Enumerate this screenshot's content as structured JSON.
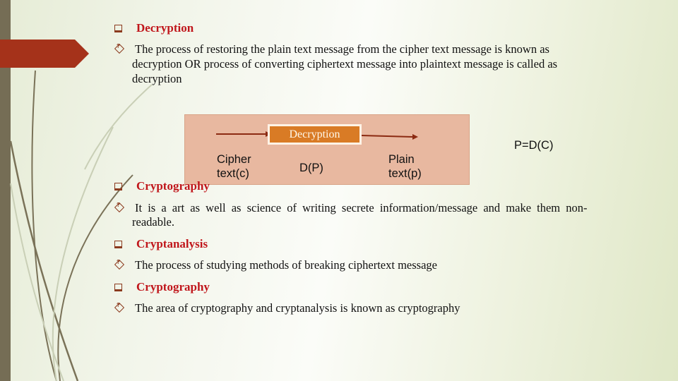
{
  "slide": {
    "sections": [
      {
        "heading": "Decryption",
        "bullet": " The process of restoring the plain text message from the cipher text message is known as",
        "bullet_lines": [
          "decryption OR process of converting ciphertext message into plaintext message is called as",
          "decryption"
        ]
      },
      {
        "heading": "Cryptography",
        "bullet": " It is a art as well as science of writing secrete information/message and make them non-",
        "bullet_lines": [
          "readable."
        ]
      },
      {
        "heading": "Cryptanalysis",
        "bullet": "The process of studying methods of breaking ciphertext message"
      },
      {
        "heading": "Cryptography",
        "bullet": "The area of cryptography and cryptanalysis is known as cryptography"
      }
    ],
    "diagram": {
      "box_label": "Decryption",
      "input_label_line1": "Cipher",
      "input_label_line2": "text(c)",
      "function_label": "D(P)",
      "output_label_line1": "Plain",
      "output_label_line2": "text(p)",
      "formula": "P=D(C)"
    },
    "colors": {
      "heading": "#c0161b",
      "banner": "#a5321a",
      "diagram_bg": "#e8b8a0",
      "decryption_box": "#d97b25",
      "arrow": "#8b2a12"
    }
  }
}
